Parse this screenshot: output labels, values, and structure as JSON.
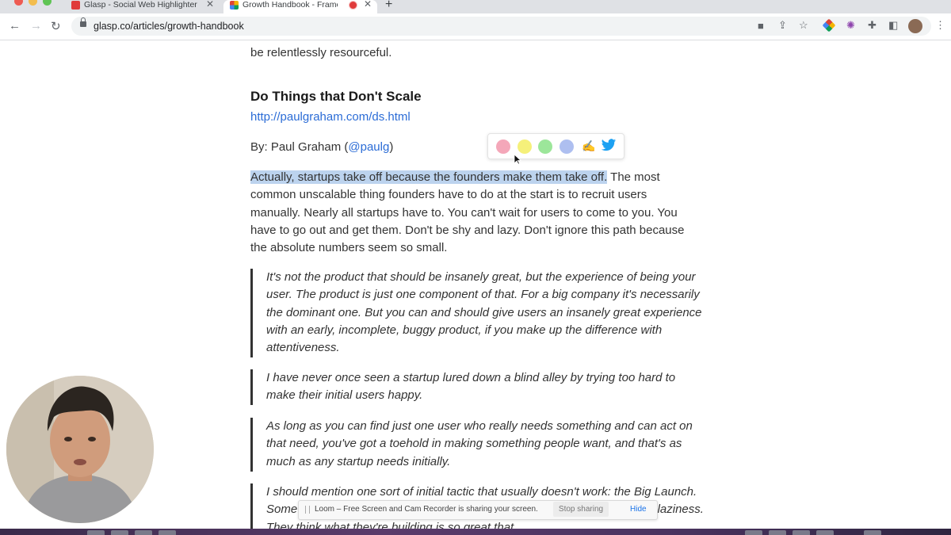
{
  "browser": {
    "tabs": [
      {
        "title": "Glasp - Social Web Highlighter",
        "favicon_color": "#e03b3b"
      },
      {
        "title": "Growth Handbook - Frame",
        "favicon_color": "#5b5bd6",
        "recording_indicator_color": "#e03b3b"
      }
    ],
    "address": "glasp.co/articles/growth-handbook",
    "icons": {
      "back": "back-arrow-icon",
      "forward": "forward-arrow-icon",
      "reload": "reload-icon",
      "new_tab": "plus-icon"
    }
  },
  "article": {
    "top_fragment": "be relentlessly resourceful.",
    "heading": "Do Things that Don't Scale",
    "link": "http://paulgraham.com/ds.html",
    "byline": {
      "prefix": "By: Paul Graham (",
      "handle": "@paulg",
      "suffix": ")"
    },
    "paragraph": {
      "highlighted": "Actually, startups take off because the founders make them take off.",
      "rest": " The most common unscalable thing founders have to do at the start is to recruit users manually. Nearly all startups have to. You can't wait for users to come to you. You have to go out and get them. Don't be shy and lazy. Don't ignore this path because the absolute numbers seem so small."
    },
    "quotes": [
      "It's not the product that should be insanely great, but the experience of being your user. The product is just one component of that. For a big company it's necessarily the dominant one. But you can and should give users an insanely great experience with an early, incomplete, buggy product, if you make up the difference with attentiveness.",
      "I have never once seen a startup lured down a blind alley by trying too hard to make their initial users happy.",
      "As long as you can find just one user who really needs something and can act on that need, you've got a toehold in making something people want, and that's as much as any startup needs initially.",
      "I should mention one sort of initial tactic that usually doesn't work: the Big Launch. Some founders seem to believe that startups are meteors... solipsism and laziness. They think what they're building is so great that"
    ],
    "highlight_color": "#bcd3ee"
  },
  "highlight_popup": {
    "colors": [
      "#f4a7b9",
      "#f5f07a",
      "#9ce69a",
      "#aebff0"
    ],
    "icons": [
      "pink-color-dot",
      "yellow-color-dot",
      "green-color-dot",
      "blue-color-dot",
      "pencil-note-icon",
      "twitter-icon"
    ]
  },
  "screen_share": {
    "message": "Loom – Free Screen and Cam Recorder is sharing your screen.",
    "stop_label": "Stop sharing",
    "hide_label": "Hide"
  }
}
